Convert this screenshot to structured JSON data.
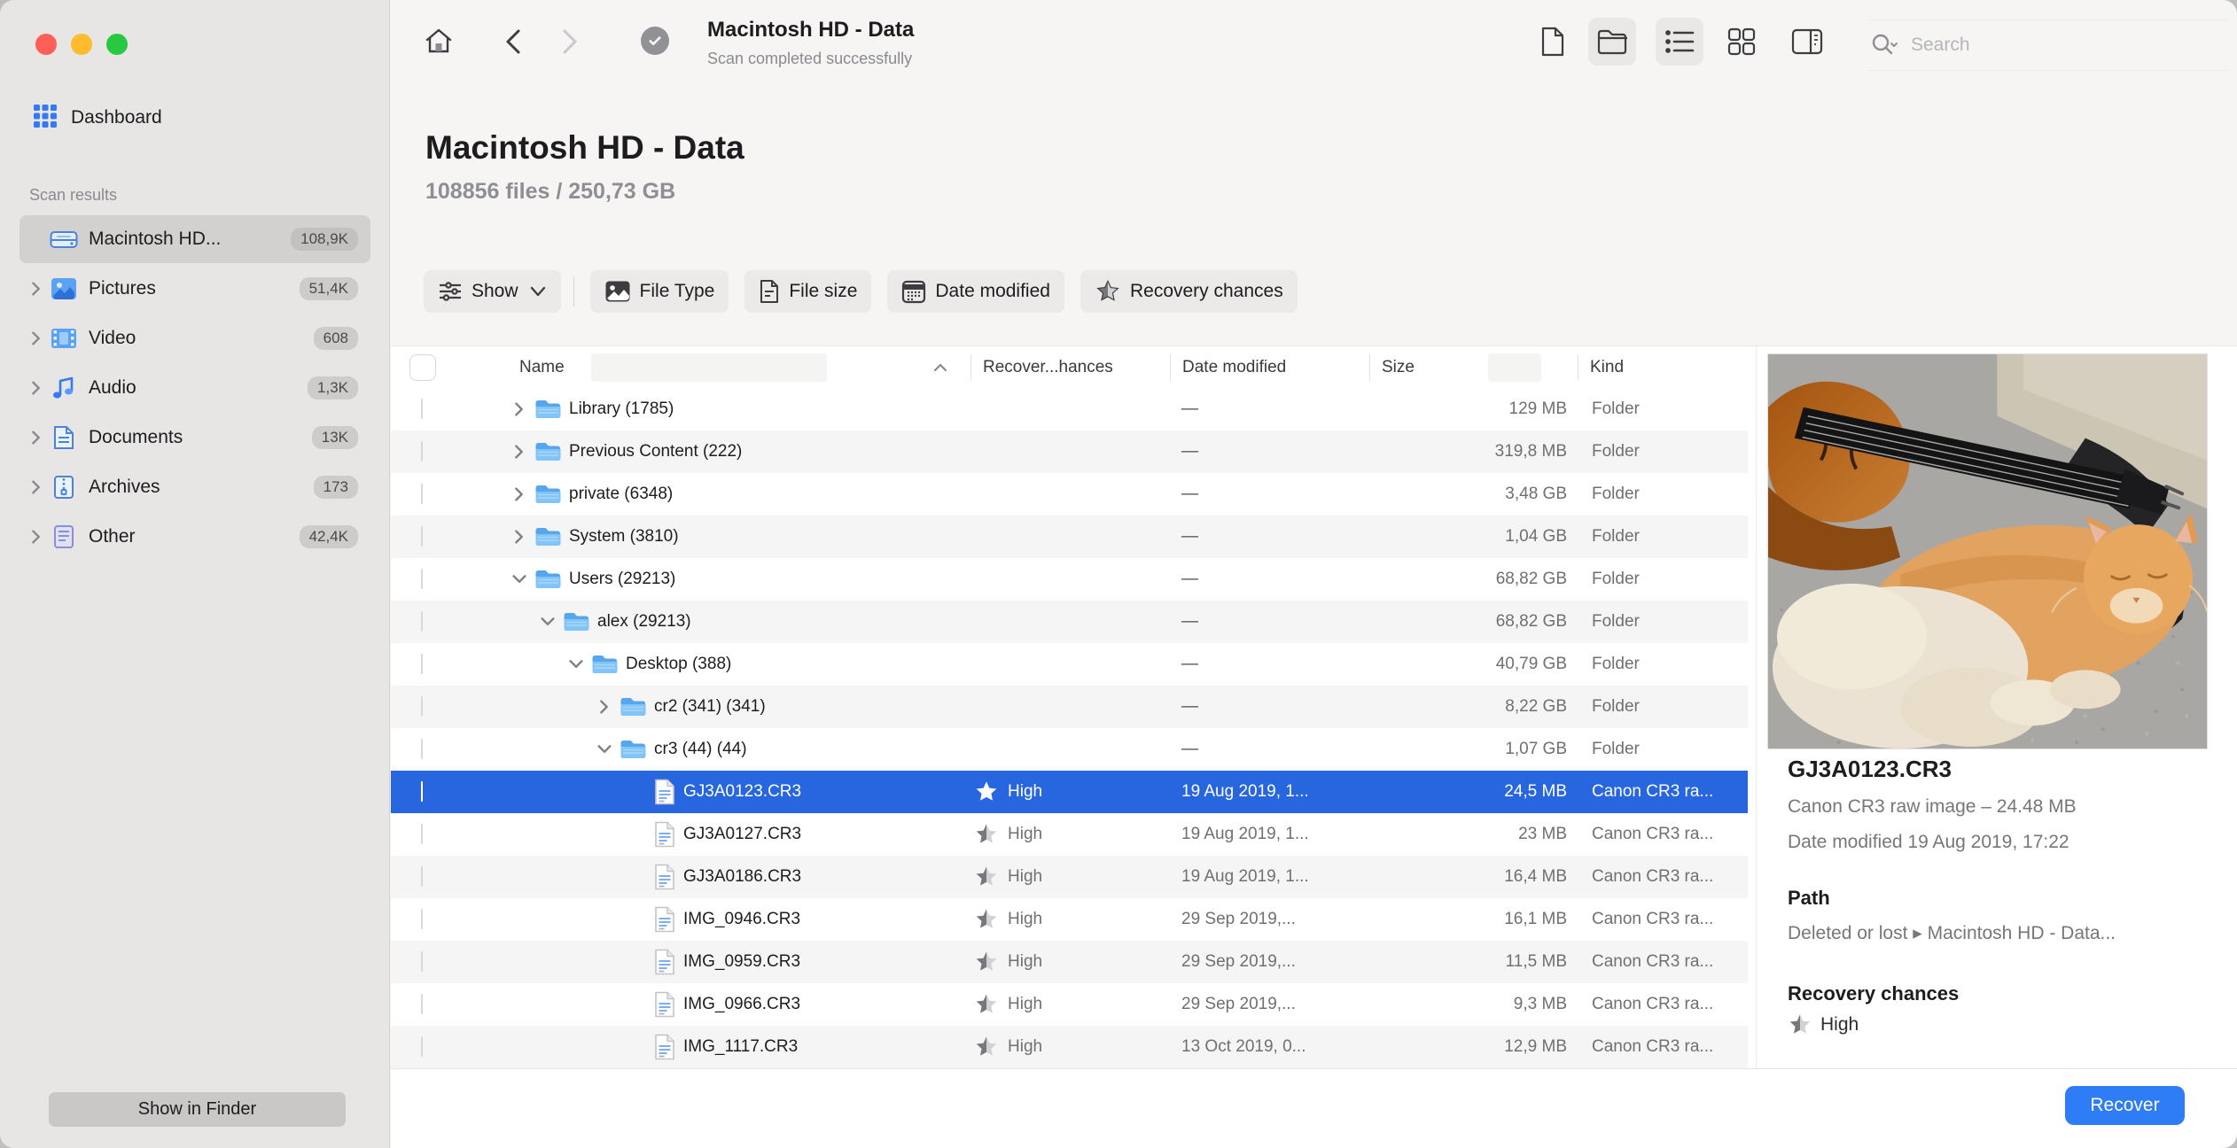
{
  "colors": {
    "accent": "#2e7cf6",
    "selection_row": "#2766df",
    "sidebar_selected": "#d2d1d0",
    "traffic": [
      "#ff5f57",
      "#febc2e",
      "#28c840"
    ]
  },
  "sidebar": {
    "dashboard_label": "Dashboard",
    "section_label": "Scan results",
    "items": [
      {
        "label": "Macintosh HD...",
        "badge": "108,9K",
        "icon": "drive",
        "selected": true,
        "chevron": null
      },
      {
        "label": "Pictures",
        "badge": "51,4K",
        "icon": "pictures",
        "selected": false,
        "chevron": "right"
      },
      {
        "label": "Video",
        "badge": "608",
        "icon": "video",
        "selected": false,
        "chevron": "right"
      },
      {
        "label": "Audio",
        "badge": "1,3K",
        "icon": "audio",
        "selected": false,
        "chevron": "right"
      },
      {
        "label": "Documents",
        "badge": "13K",
        "icon": "documents",
        "selected": false,
        "chevron": "right"
      },
      {
        "label": "Archives",
        "badge": "173",
        "icon": "archives",
        "selected": false,
        "chevron": "right"
      },
      {
        "label": "Other",
        "badge": "42,4K",
        "icon": "other",
        "selected": false,
        "chevron": "right"
      }
    ],
    "show_in_finder_label": "Show in Finder"
  },
  "toolbar": {
    "title": "Macintosh HD - Data",
    "subtitle": "Scan completed successfully",
    "search_placeholder": "Search"
  },
  "header": {
    "title": "Macintosh HD - Data",
    "stats": "108856 files / 250,73 GB"
  },
  "filters": {
    "show_label": "Show",
    "buttons": [
      {
        "label": "File Type",
        "icon": "filetype"
      },
      {
        "label": "File size",
        "icon": "filesize"
      },
      {
        "label": "Date modified",
        "icon": "datemod"
      },
      {
        "label": "Recovery chances",
        "icon": "recstar"
      }
    ]
  },
  "table": {
    "columns": {
      "name": "Name",
      "recovery": "Recover...hances",
      "date": "Date modified",
      "size": "Size",
      "kind": "Kind"
    },
    "rows": [
      {
        "type": "folder",
        "level": 0,
        "expanded": false,
        "name": "Library (1785)",
        "recovery": "",
        "date": "—",
        "size": "129 MB",
        "kind": "Folder",
        "selected": false
      },
      {
        "type": "folder",
        "level": 0,
        "expanded": false,
        "name": "Previous Content (222)",
        "recovery": "",
        "date": "—",
        "size": "319,8 MB",
        "kind": "Folder",
        "selected": false
      },
      {
        "type": "folder",
        "level": 0,
        "expanded": false,
        "name": "private (6348)",
        "recovery": "",
        "date": "—",
        "size": "3,48 GB",
        "kind": "Folder",
        "selected": false
      },
      {
        "type": "folder",
        "level": 0,
        "expanded": false,
        "name": "System (3810)",
        "recovery": "",
        "date": "—",
        "size": "1,04 GB",
        "kind": "Folder",
        "selected": false
      },
      {
        "type": "folder",
        "level": 0,
        "expanded": true,
        "name": "Users (29213)",
        "recovery": "",
        "date": "—",
        "size": "68,82 GB",
        "kind": "Folder",
        "selected": false
      },
      {
        "type": "folder",
        "level": 1,
        "expanded": true,
        "name": "alex (29213)",
        "recovery": "",
        "date": "—",
        "size": "68,82 GB",
        "kind": "Folder",
        "selected": false
      },
      {
        "type": "folder",
        "level": 2,
        "expanded": true,
        "name": "Desktop (388)",
        "recovery": "",
        "date": "—",
        "size": "40,79 GB",
        "kind": "Folder",
        "selected": false
      },
      {
        "type": "folder",
        "level": 3,
        "expanded": false,
        "name": "cr2 (341) (341)",
        "recovery": "",
        "date": "—",
        "size": "8,22 GB",
        "kind": "Folder",
        "selected": false
      },
      {
        "type": "folder",
        "level": 3,
        "expanded": true,
        "name": "cr3 (44) (44)",
        "recovery": "",
        "date": "—",
        "size": "1,07 GB",
        "kind": "Folder",
        "selected": false
      },
      {
        "type": "file",
        "level": 4,
        "expanded": null,
        "name": "GJ3A0123.CR3",
        "recovery": "High",
        "date": "19 Aug 2019, 1...",
        "size": "24,5 MB",
        "kind": "Canon CR3 ra...",
        "selected": true
      },
      {
        "type": "file",
        "level": 4,
        "expanded": null,
        "name": "GJ3A0127.CR3",
        "recovery": "High",
        "date": "19 Aug 2019, 1...",
        "size": "23 MB",
        "kind": "Canon CR3 ra...",
        "selected": false
      },
      {
        "type": "file",
        "level": 4,
        "expanded": null,
        "name": "GJ3A0186.CR3",
        "recovery": "High",
        "date": "19 Aug 2019, 1...",
        "size": "16,4 MB",
        "kind": "Canon CR3 ra...",
        "selected": false
      },
      {
        "type": "file",
        "level": 4,
        "expanded": null,
        "name": "IMG_0946.CR3",
        "recovery": "High",
        "date": "29 Sep 2019,...",
        "size": "16,1 MB",
        "kind": "Canon CR3 ra...",
        "selected": false
      },
      {
        "type": "file",
        "level": 4,
        "expanded": null,
        "name": "IMG_0959.CR3",
        "recovery": "High",
        "date": "29 Sep 2019,...",
        "size": "11,5 MB",
        "kind": "Canon CR3 ra...",
        "selected": false
      },
      {
        "type": "file",
        "level": 4,
        "expanded": null,
        "name": "IMG_0966.CR3",
        "recovery": "High",
        "date": "29 Sep 2019,...",
        "size": "9,3 MB",
        "kind": "Canon CR3 ra...",
        "selected": false
      },
      {
        "type": "file",
        "level": 4,
        "expanded": null,
        "name": "IMG_1117.CR3",
        "recovery": "High",
        "date": "13 Oct 2019, 0...",
        "size": "12,9 MB",
        "kind": "Canon CR3 ra...",
        "selected": false
      }
    ]
  },
  "preview": {
    "filename": "GJ3A0123.CR3",
    "type_size": "Canon CR3 raw image – 24.48 MB",
    "date_line": "Date modified 19 Aug 2019, 17:22",
    "path_label": "Path",
    "path_value": "Deleted or lost ▸ Macintosh HD - Data...",
    "recovery_label": "Recovery chances",
    "recovery_value": "High"
  },
  "footer": {
    "recover_label": "Recover"
  }
}
